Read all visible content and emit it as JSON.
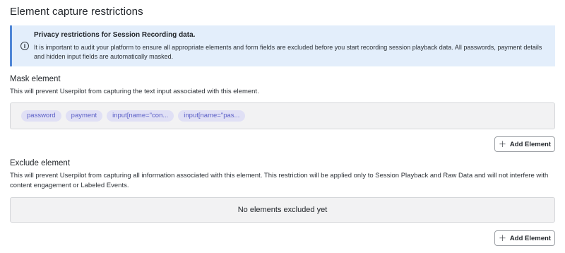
{
  "page": {
    "title": "Element capture restrictions"
  },
  "banner": {
    "icon": "info-icon",
    "title": "Privacy restrictions for Session Recording data.",
    "body": "It is important to audit your platform to ensure all appropriate elements and form fields are excluded before you start recording session playback data. All passwords, payment details and hidden input fields are automatically masked.",
    "colors": {
      "background": "#e3eefb",
      "accent": "#4f86d6"
    }
  },
  "mask": {
    "title": "Mask element",
    "description": "This will prevent Userpilot from capturing the text input associated with this element.",
    "tags": [
      "password",
      "payment",
      "input[name=\"con...",
      "input[name=\"pas..."
    ],
    "add_button_label": "Add Element",
    "tag_color": "#5b5fc7",
    "tag_background": "#e0e0f5"
  },
  "exclude": {
    "title": "Exclude element",
    "description": "This will prevent Userpilot from capturing all information associated with this element. This restriction will be applied only to Session Playback and Raw Data and will not interfere with content engagement or Labeled Events.",
    "empty_text": "No elements excluded yet",
    "add_button_label": "Add Element"
  }
}
